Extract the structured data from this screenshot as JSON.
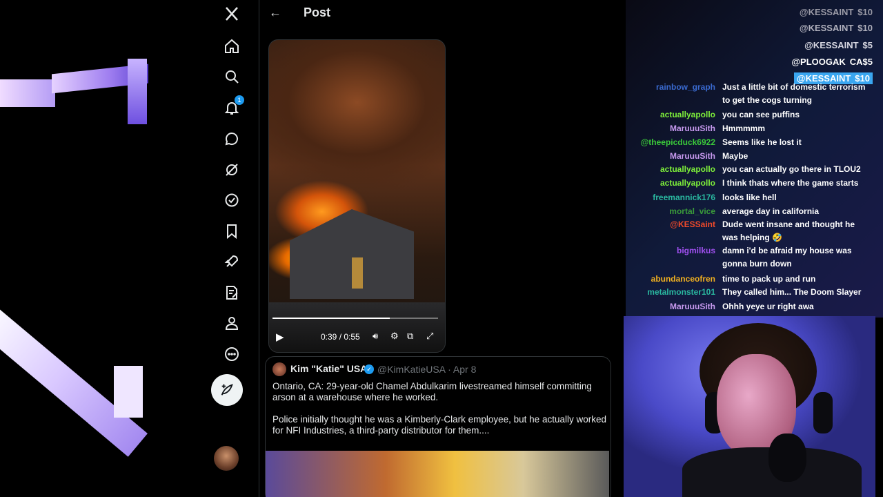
{
  "nav": {
    "brand_icon": "x-logo-icon",
    "items": [
      {
        "name": "home-icon"
      },
      {
        "name": "search-icon"
      },
      {
        "name": "bell-icon",
        "badge": "1"
      },
      {
        "name": "messages-icon"
      },
      {
        "name": "grok-icon"
      },
      {
        "name": "verified-icon"
      },
      {
        "name": "bookmark-icon"
      },
      {
        "name": "rocket-icon"
      },
      {
        "name": "compose-list-icon"
      },
      {
        "name": "profile-icon"
      },
      {
        "name": "more-icon"
      }
    ],
    "compose_icon": "feather-plus-icon"
  },
  "header": {
    "back_glyph": "←",
    "title": "Post"
  },
  "video": {
    "current_time": "0:39",
    "duration": "0:55",
    "time_display": "0:39 / 0:55",
    "progress": 0.71
  },
  "quote": {
    "name": "Kim \"Katie\" USA",
    "handle_date": "@KimKatieUSA · Apr 8",
    "paragraph1": "Ontario, CA: 29-year-old Chamel Abdulkarim livestreamed himself committing arson at a warehouse where he worked.",
    "paragraph2": "Police initially thought he was a Kimberly-Clark employee, but he actually worked for NFI Industries, a third-party distributor for them...."
  },
  "donations": [
    {
      "user": "@KESSAINT",
      "amount": "$10",
      "color": "#9a9aa6"
    },
    {
      "user": "@KESSAINT",
      "amount": "$10",
      "color": "#b0b0bc"
    },
    {
      "user": "@KESSAINT",
      "amount": "$5",
      "color": "#d8d8e2"
    },
    {
      "user": "@PLOOGAK",
      "amount": "CA$5",
      "color": "#ffffff"
    },
    {
      "user": "@KESSAINT",
      "amount": "$10",
      "color": "#ffffff",
      "highlight": true
    }
  ],
  "chat": [
    {
      "user": "rainbow_graph",
      "text": "Just a little bit of domestic terrorism to get the cogs turning",
      "color": "#3a6ad0"
    },
    {
      "user": "actuallyapollo",
      "text": "you can see puffins",
      "color": "#7ef03a"
    },
    {
      "user": "MaruuuSith",
      "text": "Hmmmmm",
      "color": "#c89af0"
    },
    {
      "user": "@theepicduck6922",
      "text": "Seems like he lost it",
      "color": "#3ac83a"
    },
    {
      "user": "MaruuuSith",
      "text": "Maybe",
      "color": "#c89af0"
    },
    {
      "user": "actuallyapollo",
      "text": "you can actually go there in TLOU2",
      "color": "#7ef03a"
    },
    {
      "user": "actuallyapollo",
      "text": "I think thats where the game starts",
      "color": "#7ef03a"
    },
    {
      "user": "freemannick176",
      "text": "looks like hell",
      "color": "#2ab8a0"
    },
    {
      "user": "mortal_vice",
      "text": "average day in california",
      "color": "#3a9a3a"
    },
    {
      "user": "@KESSaint",
      "text": "Dude went insane and thought he was helping 🤣",
      "color": "#f04a2a"
    },
    {
      "user": "bigmilkus",
      "text": "damn i'd be afraid my house was gonna burn down",
      "color": "#a050f0"
    },
    {
      "user": "abundanceofren",
      "text": "time to pack up and run",
      "color": "#f0b020"
    },
    {
      "user": "metalmonster101",
      "text": "They called him... The Doom Slayer",
      "color": "#2ab8a0"
    },
    {
      "user": "MaruuuSith",
      "text": "Ohhh yeye ur right awa",
      "color": "#c89af0"
    }
  ]
}
